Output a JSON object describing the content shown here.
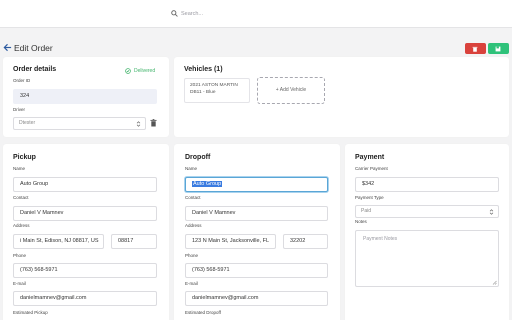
{
  "search": {
    "placeholder": "Search..."
  },
  "header": {
    "title": "Edit Order"
  },
  "order_details": {
    "title": "Order details",
    "status": "Delivered",
    "order_id_label": "Order ID",
    "order_id": "324",
    "driver_label": "Driver",
    "driver_value": "Dtester"
  },
  "vehicles": {
    "title": "Vehicles (1)",
    "items": [
      "2021 ASTON MARTIN DB11 - Blue"
    ],
    "add_label": "+ Add Vehicle"
  },
  "pickup": {
    "title": "Pickup",
    "name_label": "Name",
    "name": "Auto Group",
    "contact_label": "Contact",
    "contact": "Daniel V Mamnev",
    "address_label": "Address",
    "address": "i Main St, Edison, NJ 08817, US",
    "zip": "08817",
    "phone_label": "Phone",
    "phone": "(763) 568-5971",
    "email_label": "E-mail",
    "email": "danielmamnev@gmail.com",
    "est_label": "Estimated Pickup"
  },
  "dropoff": {
    "title": "Dropoff",
    "name_label": "Name",
    "name": "Auto Group",
    "contact_label": "Contact",
    "contact": "Daniel V Mamnev",
    "address_label": "Address",
    "address": "123 N Main St, Jacksonville, FL",
    "zip": "32202",
    "phone_label": "Phone",
    "phone": "(763) 568-5971",
    "email_label": "E-mail",
    "email": "danielmamnev@gmail.com",
    "est_label": "Estimated Dropoff"
  },
  "payment": {
    "title": "Payment",
    "carrier_label": "Carrier Payment",
    "carrier_value": "$342",
    "type_label": "Payment Type",
    "type_value": "Paid",
    "notes_label": "Notes",
    "notes_placeholder": "Payment Notes"
  },
  "colors": {
    "danger": "#d9423c",
    "success": "#2fc27a",
    "status_green": "#3fb36a",
    "accent_blue": "#2c5aa0"
  }
}
